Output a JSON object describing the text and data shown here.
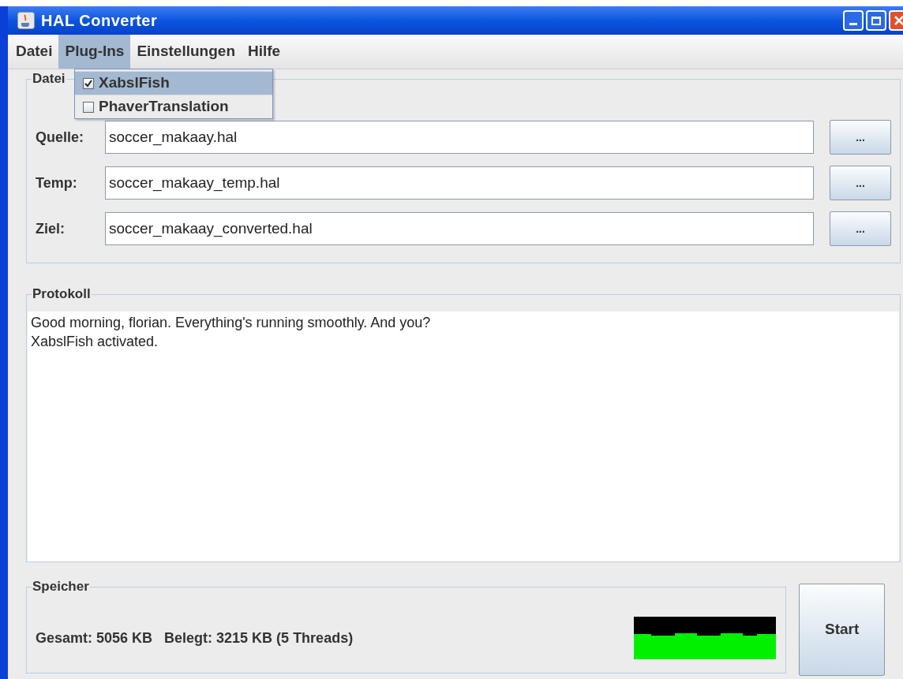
{
  "window": {
    "title": "HAL Converter"
  },
  "menu_bar": [
    {
      "label": "Datei",
      "selected": false
    },
    {
      "label": "Plug-Ins",
      "selected": true
    },
    {
      "label": "Einstellungen",
      "selected": false
    },
    {
      "label": "Hilfe",
      "selected": false
    }
  ],
  "open_menu": [
    {
      "label": "XabslFish",
      "checked": true,
      "selected": true
    },
    {
      "label": "PhaverTranslation",
      "checked": false,
      "selected": false
    }
  ],
  "files": {
    "title": "Datei",
    "rows": [
      {
        "label": "Quelle:",
        "value": "soccer_makaay.hal",
        "button": "..."
      },
      {
        "label": "Temp:",
        "value": "soccer_makaay_temp.hal",
        "button": "..."
      },
      {
        "label": "Ziel:",
        "value": "soccer_makaay_converted.hal",
        "button": "..."
      }
    ]
  },
  "log": {
    "title": "Protokoll",
    "lines": [
      "Good morning, florian. Everything's running smoothly. And you?",
      "XabslFish activated."
    ]
  },
  "memory": {
    "title": "Speicher",
    "summary": "Gesamt: 5056 KB   Belegt: 3215 KB (5 Threads)"
  },
  "start_button": "Start"
}
